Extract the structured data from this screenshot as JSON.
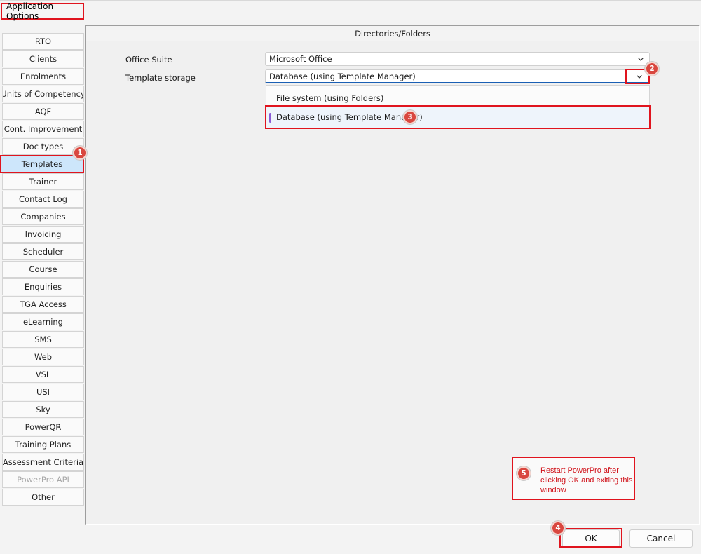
{
  "window": {
    "title": "Application Options"
  },
  "sidebar": {
    "items": [
      {
        "label": "RTO",
        "state": "normal"
      },
      {
        "label": "Clients",
        "state": "normal"
      },
      {
        "label": "Enrolments",
        "state": "normal"
      },
      {
        "label": "Units of Competency",
        "state": "normal"
      },
      {
        "label": "AQF",
        "state": "normal"
      },
      {
        "label": "Cont. Improvement",
        "state": "normal"
      },
      {
        "label": "Doc types",
        "state": "normal"
      },
      {
        "label": "Templates",
        "state": "selected"
      },
      {
        "label": "Trainer",
        "state": "normal"
      },
      {
        "label": "Contact Log",
        "state": "normal"
      },
      {
        "label": "Companies",
        "state": "normal"
      },
      {
        "label": "Invoicing",
        "state": "normal"
      },
      {
        "label": "Scheduler",
        "state": "normal"
      },
      {
        "label": "Course",
        "state": "normal"
      },
      {
        "label": "Enquiries",
        "state": "normal"
      },
      {
        "label": "TGA Access",
        "state": "normal"
      },
      {
        "label": "eLearning",
        "state": "normal"
      },
      {
        "label": "SMS",
        "state": "normal"
      },
      {
        "label": "Web",
        "state": "normal"
      },
      {
        "label": "VSL",
        "state": "normal"
      },
      {
        "label": "USI",
        "state": "normal"
      },
      {
        "label": "Sky",
        "state": "normal"
      },
      {
        "label": "PowerQR",
        "state": "normal"
      },
      {
        "label": "Training Plans",
        "state": "normal"
      },
      {
        "label": "Assessment Criteria",
        "state": "normal"
      },
      {
        "label": "PowerPro API",
        "state": "disabled"
      },
      {
        "label": "Other",
        "state": "normal"
      }
    ]
  },
  "panel": {
    "header": "Directories/Folders",
    "office_suite": {
      "label": "Office Suite",
      "value": "Microsoft Office"
    },
    "template_storage": {
      "label": "Template storage",
      "value": "Database (using Template Manager)",
      "options": [
        "File system (using Folders)",
        "Database (using Template Manager)"
      ],
      "selected_index": 1
    }
  },
  "annotations": {
    "badges": [
      "1",
      "2",
      "3",
      "4",
      "5"
    ],
    "note": "Restart PowerPro after clicking OK and exiting this window",
    "colors": {
      "highlight_red": "#e0141e",
      "badge_red": "#d9473f",
      "selected_blue": "#cde6fb",
      "focus_blue": "#1a5fb4",
      "accent_purple": "#8a5bd6"
    }
  },
  "footer": {
    "ok_label": "OK",
    "cancel_label": "Cancel"
  },
  "icons": {
    "dropdown": "chevron-down-icon"
  }
}
